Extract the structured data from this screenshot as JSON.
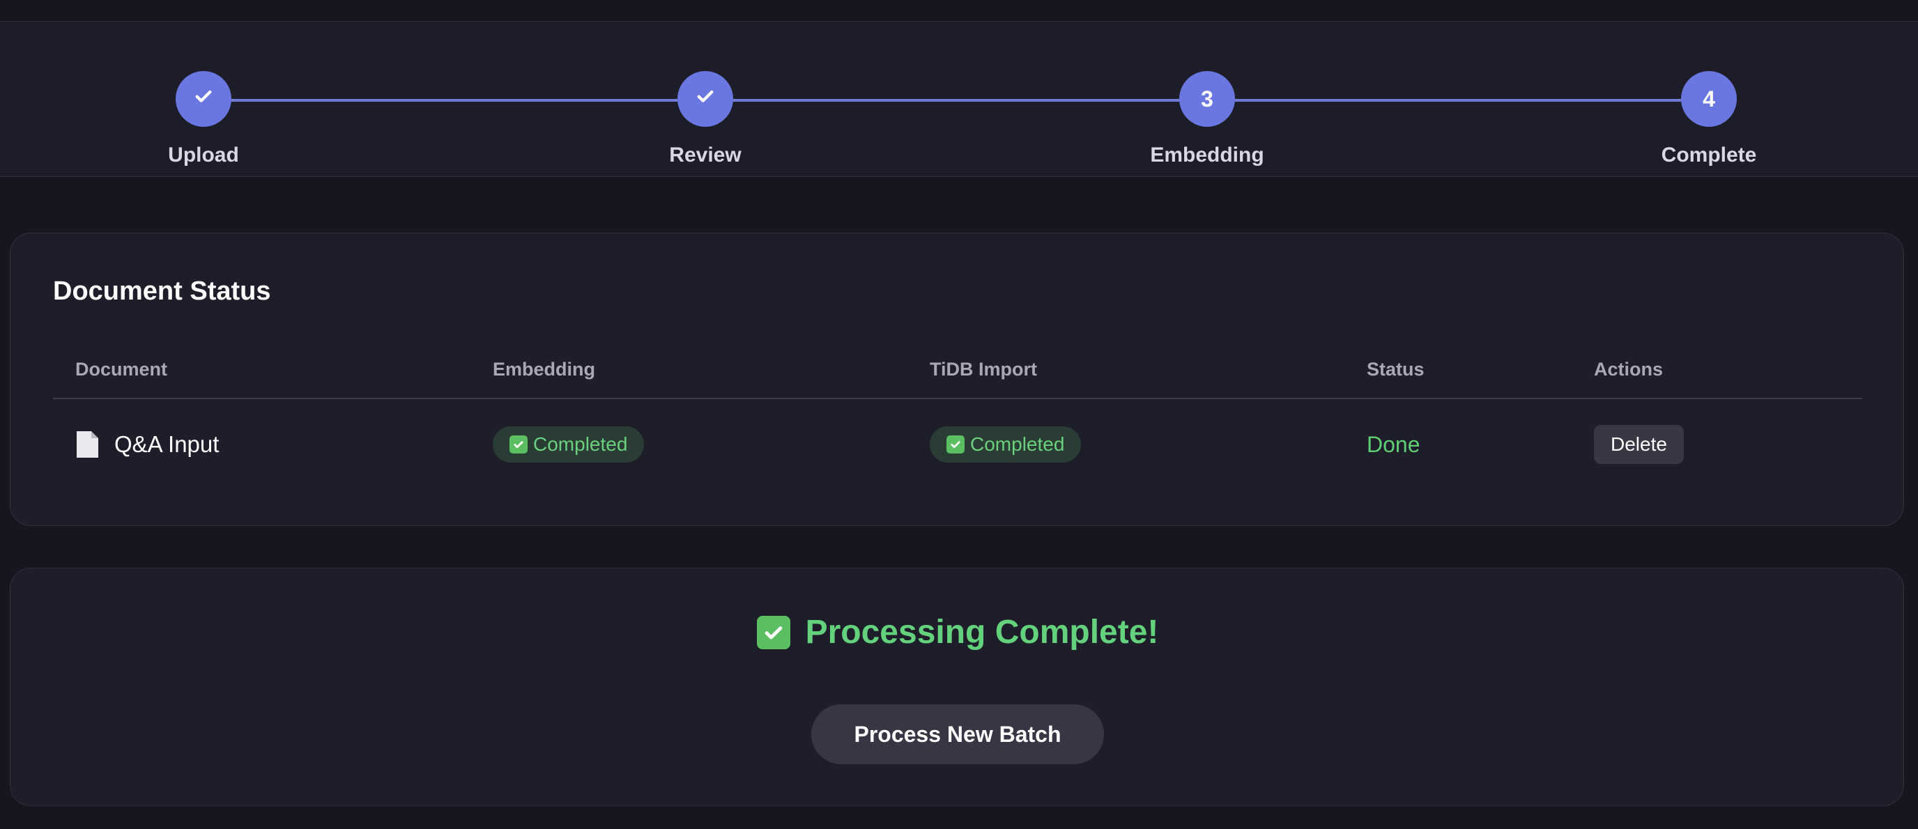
{
  "stepper": {
    "steps": [
      {
        "label": "Upload",
        "marker": "",
        "icon": "check-icon",
        "state": "done"
      },
      {
        "label": "Review",
        "marker": "",
        "icon": "check-icon",
        "state": "done"
      },
      {
        "label": "Embedding",
        "marker": "3",
        "state": "active"
      },
      {
        "label": "Complete",
        "marker": "4",
        "state": "pending"
      }
    ]
  },
  "document_status": {
    "title": "Document Status",
    "columns": [
      "Document",
      "Embedding",
      "TiDB Import",
      "Status",
      "Actions"
    ],
    "rows": [
      {
        "document": "Q&A Input",
        "document_icon": "file-icon",
        "embedding": "Completed",
        "tidb_import": "Completed",
        "status": "Done",
        "action": "Delete"
      }
    ]
  },
  "completion": {
    "message": "Processing Complete!",
    "icon": "check-box-icon",
    "button_label": "Process New Batch"
  },
  "colors": {
    "accent": "#6b77e0",
    "success": "#5fcf73",
    "background": "#16161f",
    "card": "#1e1e2b"
  }
}
